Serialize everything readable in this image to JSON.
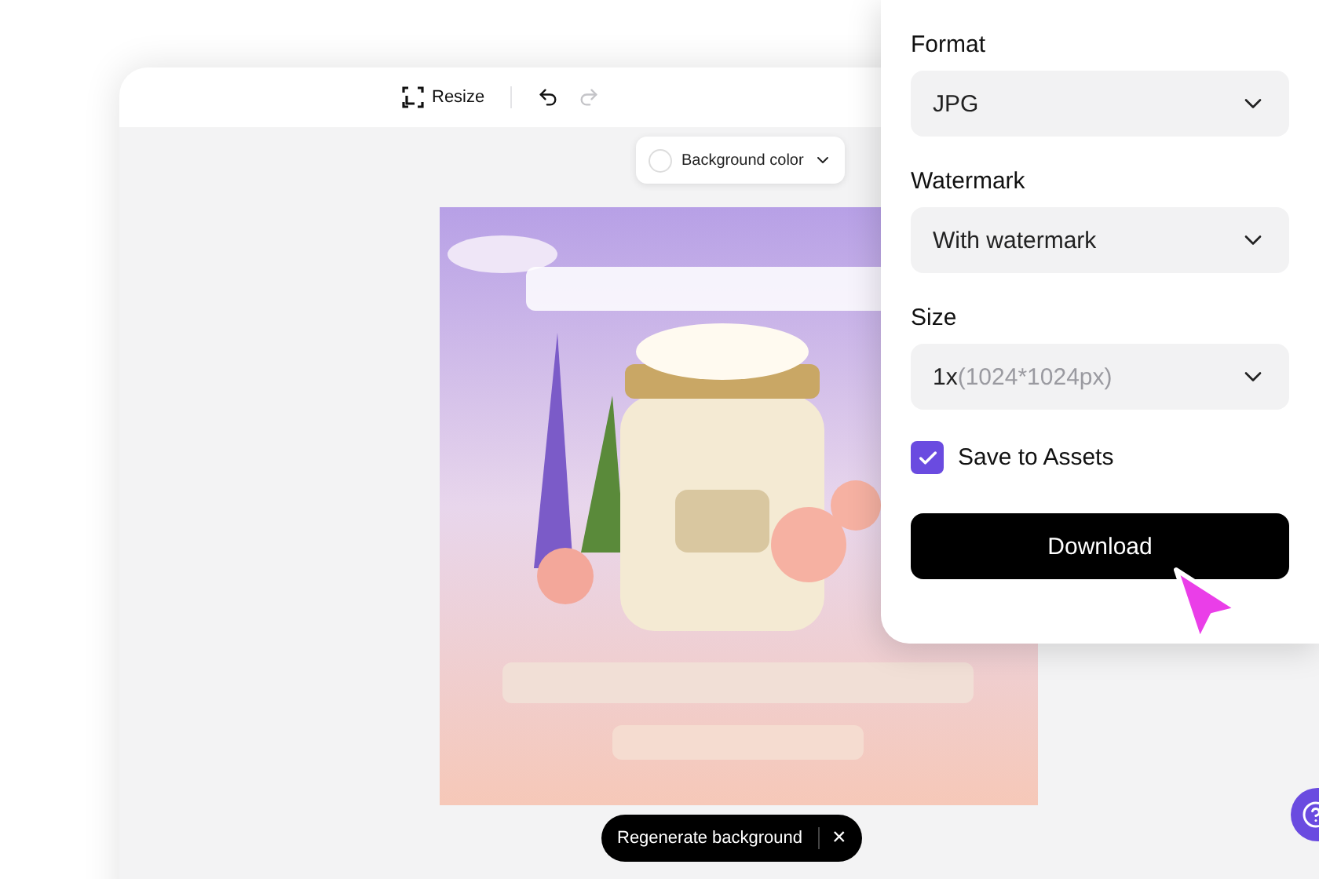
{
  "toolbar": {
    "resize": "Resize",
    "undo_disabled": false,
    "redo_disabled": true
  },
  "background_color": {
    "label": "Background color"
  },
  "regenerate": {
    "label": "Regenerate background",
    "close": "×"
  },
  "download_panel": {
    "fields": [
      {
        "label": "Format",
        "value": "JPG"
      },
      {
        "label": "Watermark",
        "value": "With watermark"
      },
      {
        "label": "Size",
        "value": "1x",
        "detail": "(1024*1024px)"
      }
    ],
    "save_to_assets": {
      "label": "Save to Assets",
      "checked": true
    },
    "button": "Download"
  }
}
